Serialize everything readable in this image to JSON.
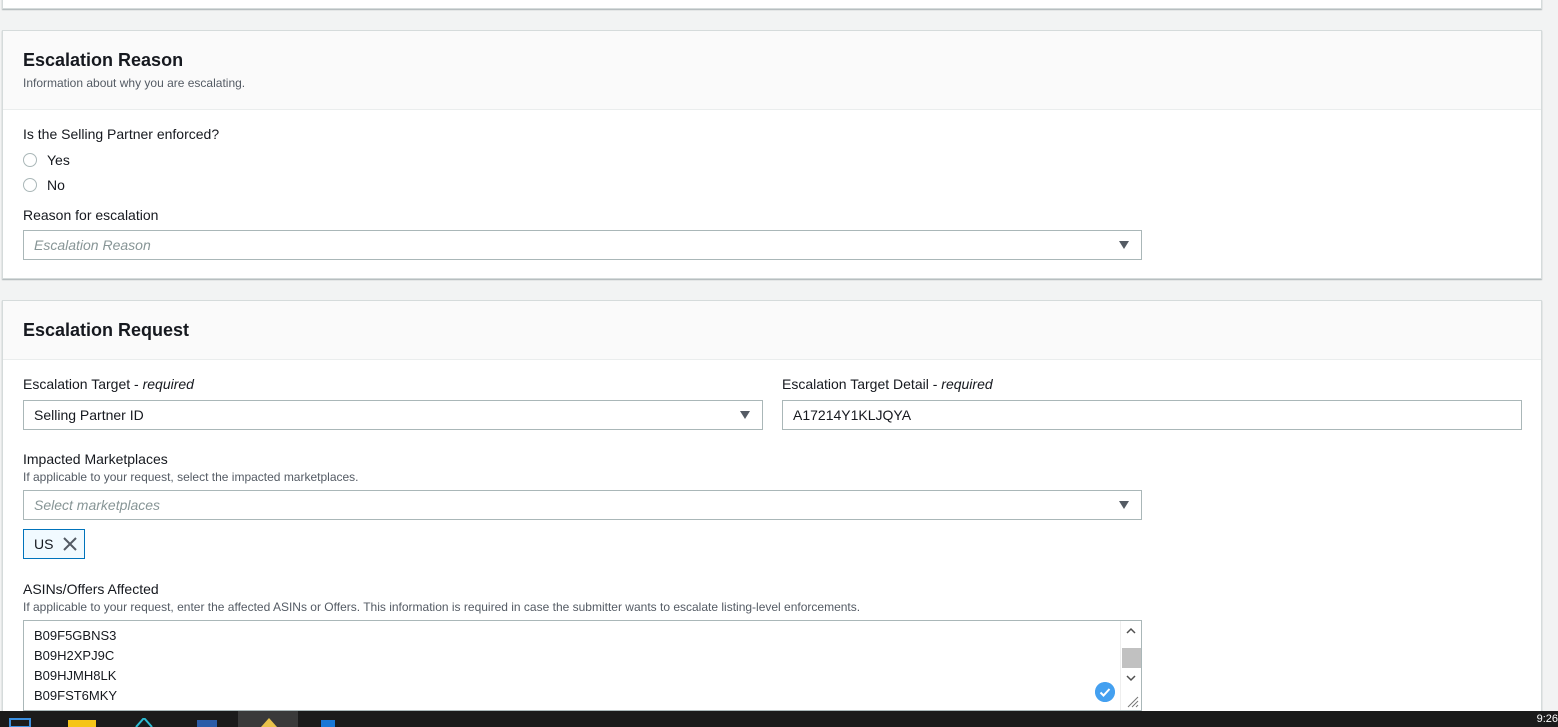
{
  "reason_section": {
    "title": "Escalation Reason",
    "description": "Information about why you are escalating.",
    "enforced_question": "Is the Selling Partner enforced?",
    "enforced_options": [
      "Yes",
      "No"
    ],
    "reason_label": "Reason for escalation",
    "reason_placeholder": "Escalation Reason"
  },
  "request_section": {
    "title": "Escalation Request",
    "target_label": "Escalation Target",
    "target_required": "required",
    "target_value": "Selling Partner ID",
    "target_detail_label": "Escalation Target Detail",
    "target_detail_required": "required",
    "target_detail_value": "A17214Y1KLJQYA",
    "marketplaces_label": "Impacted Marketplaces",
    "marketplaces_description": "If applicable to your request, select the impacted marketplaces.",
    "marketplaces_placeholder": "Select marketplaces",
    "selected_marketplaces": [
      "US"
    ],
    "asins_label": "ASINs/Offers Affected",
    "asins_description": "If applicable to your request, enter the affected ASINs or Offers. This information is required in case the submitter wants to escalate listing-level enforcements.",
    "asins": [
      "B09F5GBNS3",
      "B09H2XPJ9C",
      "B09HJMH8LK",
      "B09FST6MKY"
    ]
  },
  "taskbar": {
    "clock": "9:26"
  },
  "colors": {
    "accent": "#0073bb",
    "token_bg": "#f1faff",
    "check": "#44a0f0"
  }
}
